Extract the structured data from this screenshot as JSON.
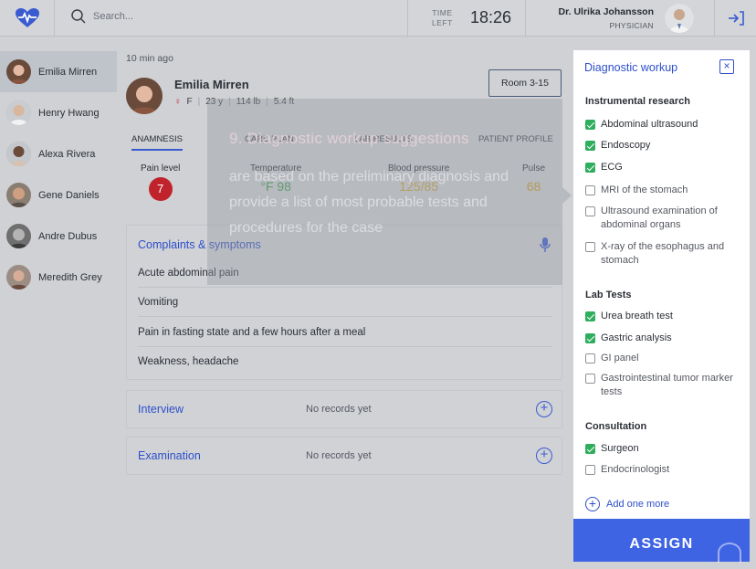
{
  "header": {
    "search_placeholder": "Search...",
    "time_label_1": "TIME",
    "time_label_2": "LEFT",
    "time_value": "18:26",
    "doctor_name": "Dr. Ulrika Johansson",
    "doctor_role": "PHYSICIAN"
  },
  "sidebar": {
    "patients": [
      {
        "name": "Emilia Mirren",
        "active": true
      },
      {
        "name": "Henry Hwang",
        "active": false
      },
      {
        "name": "Alexa Rivera",
        "active": false
      },
      {
        "name": "Gene Daniels",
        "active": false
      },
      {
        "name": "Andre Dubus",
        "active": false
      },
      {
        "name": "Meredith Grey",
        "active": false
      }
    ]
  },
  "main": {
    "time_ago": "10 min ago",
    "patient": {
      "name": "Emilia Mirren",
      "sex": "F",
      "age": "23 y",
      "weight": "114 lb",
      "height": "5.4 ft",
      "room": "Room 3-15"
    },
    "tabs": [
      "ANAMNESIS",
      "CARE PLAN",
      "LAB RESULTS",
      "PATIENT PROFILE"
    ],
    "vitals": {
      "pain_label": "Pain level",
      "pain_value": "7",
      "temp_label": "Temperature",
      "temp_value": "°F 98",
      "bp_label": "Blood pressure",
      "bp_value": "125/85",
      "pulse_label": "Pulse",
      "pulse_value": "68"
    },
    "complaints": {
      "title": "Complaints & symptoms",
      "items": [
        "Acute abdominal pain",
        "Vomiting",
        "Pain in fasting state and a few hours after a meal",
        "Weakness, headache"
      ]
    },
    "interview": {
      "title": "Interview",
      "status": "No records yet"
    },
    "examination": {
      "title": "Examination",
      "status": "No records yet"
    }
  },
  "tooltip": {
    "title": "9. Diagnostic workup suggestions",
    "body": "are based on the preliminary diagnosis and provide a list of most probable tests and procedures for the case"
  },
  "panel": {
    "title": "Diagnostic workup",
    "sections": {
      "instrumental": {
        "title": "Instrumental research",
        "items": [
          {
            "label": "Abdominal ultrasound",
            "checked": true
          },
          {
            "label": "Endoscopy",
            "checked": true
          },
          {
            "label": "ECG",
            "checked": true
          },
          {
            "label": "MRI of the stomach",
            "checked": false
          },
          {
            "label": "Ultrasound examination of abdominal organs",
            "checked": false
          },
          {
            "label": "X-ray of the esophagus and stomach",
            "checked": false
          }
        ]
      },
      "lab": {
        "title": "Lab Tests",
        "items": [
          {
            "label": "Urea breath test",
            "checked": true
          },
          {
            "label": "Gastric analysis",
            "checked": true
          },
          {
            "label": "GI panel",
            "checked": false
          },
          {
            "label": "Gastrointestinal tumor marker tests",
            "checked": false
          }
        ]
      },
      "consultation": {
        "title": "Consultation",
        "items": [
          {
            "label": "Surgeon",
            "checked": true
          },
          {
            "label": "Endocrinologist",
            "checked": false
          }
        ]
      }
    },
    "add_more": "Add one more",
    "assign_button": "ASSIGN"
  },
  "colors": {
    "accent": "#3e63e3",
    "check_green": "#2fae5e",
    "pain_red": "#c0232b",
    "temp_green": "#3e9a4e",
    "bp_amber": "#c9a13a",
    "pulse_amber": "#c99a2a"
  }
}
